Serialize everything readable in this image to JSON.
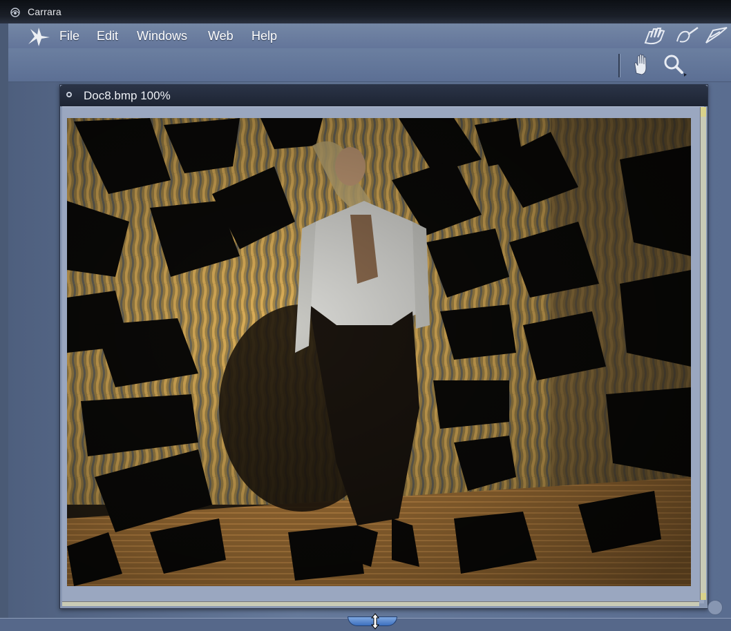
{
  "window": {
    "title": "Carrara"
  },
  "menubar": {
    "items": [
      {
        "label": "File"
      },
      {
        "label": "Edit"
      },
      {
        "label": "Windows"
      },
      {
        "label": "Web"
      },
      {
        "label": "Help"
      }
    ],
    "right_icons": [
      "assemble-room-hand-icon",
      "model-room-icon",
      "storyboard-room-icon"
    ]
  },
  "toolbar": {
    "tools": [
      {
        "icon": "pan-hand-icon"
      },
      {
        "icon": "zoom-magnifier-icon"
      }
    ]
  },
  "document": {
    "title": "Doc8.bmp 100%"
  },
  "colors": {
    "menubar": "#6b7fa0",
    "workspace": "#5f6f88",
    "doc_title_bar": "#1d2433",
    "splitter": "#3c6fbe"
  }
}
